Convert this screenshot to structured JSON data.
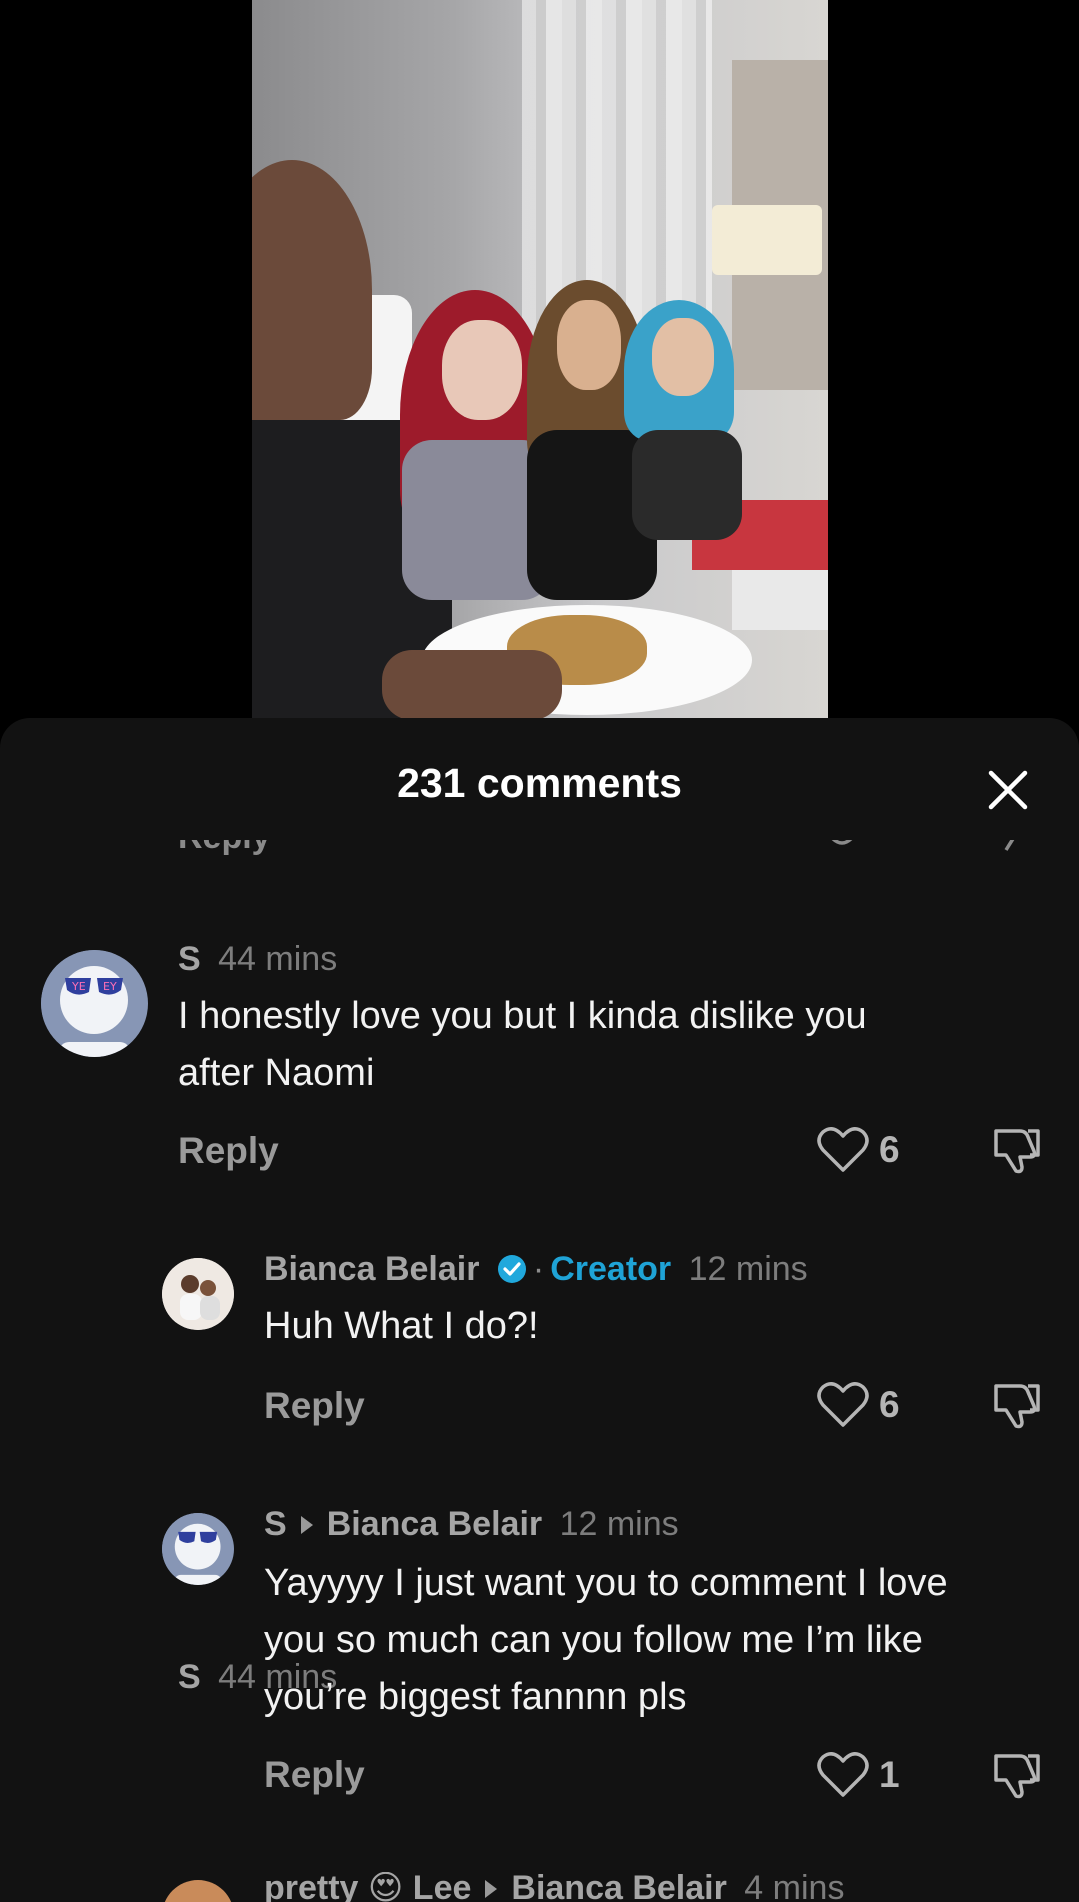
{
  "video": {
    "description_icon": "video-thumbnail"
  },
  "sheet": {
    "title": "231 comments",
    "close_icon": "close-icon",
    "partial_top_reply": "Reply"
  },
  "comments": [
    {
      "author": "S",
      "time": "44 mins",
      "text_lines": [
        "I honestly love you but I kinda dislike you",
        "after Naomi"
      ],
      "reply_label": "Reply",
      "likes": "6"
    },
    {
      "author": "Bianca Belair",
      "verified": true,
      "badge": "Creator",
      "time": "12 mins",
      "text_lines": [
        "Huh What I do?!"
      ],
      "reply_label": "Reply",
      "likes": "6"
    },
    {
      "author": "S",
      "reply_to": "Bianca Belair",
      "time": "12 mins",
      "text_lines": [
        "Yayyyy I just want you to comment I love",
        "you so much can you follow me I’m like",
        "you’re biggest fannnn pls"
      ],
      "reply_label": "Reply",
      "likes": "1"
    },
    {
      "author": "pretty 😍 Lee",
      "reply_to": "Bianca Belair",
      "time": "4 mins"
    }
  ],
  "colors": {
    "sheet_bg": "#121212",
    "creator_accent": "#1fa3d6",
    "text_primary": "#f2f2f2",
    "text_secondary": "#8d8d8d"
  }
}
